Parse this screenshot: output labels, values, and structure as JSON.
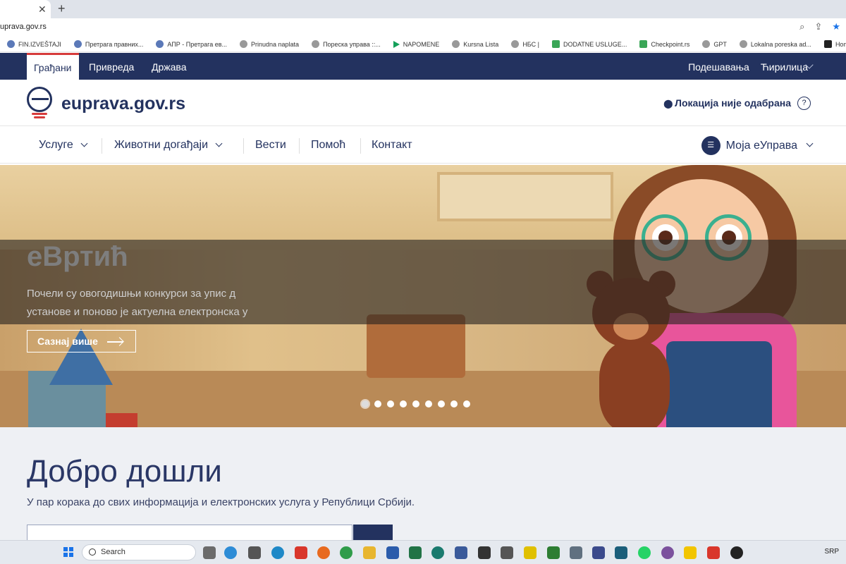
{
  "browser": {
    "url": "uprava.gov.rs",
    "bookmarks": [
      {
        "label": "FIN.IZVEŠTAJI",
        "icon": "globe-icon"
      },
      {
        "label": "Претрага правних...",
        "icon": "globe-icon"
      },
      {
        "label": "АПР - Претрага ев...",
        "icon": "globe-icon"
      },
      {
        "label": "Prinudna naplata",
        "icon": "globe-icon"
      },
      {
        "label": "Пореска управа ::...",
        "icon": "globe-icon"
      },
      {
        "label": "NAPOMENE",
        "icon": "play-icon"
      },
      {
        "label": "Kursna Lista",
        "icon": "globe-icon"
      },
      {
        "label": "НБС |",
        "icon": "globe-icon"
      },
      {
        "label": "DODATNE USLUGE...",
        "icon": "sheet-icon"
      },
      {
        "label": "Checkpoint.rs",
        "icon": "check-icon"
      },
      {
        "label": "GPT",
        "icon": "globe-icon"
      },
      {
        "label": "Lokalna poreska ad...",
        "icon": "globe-icon"
      },
      {
        "label": "Home - Calculus",
        "icon": "sd-icon"
      }
    ]
  },
  "topbar": {
    "segments": [
      "Грађани",
      "Привреда",
      "Држава"
    ],
    "settings": "Подешавања",
    "language": "Ћирилица"
  },
  "header": {
    "logo_text": "euprava.gov.rs",
    "location": "Локација није одабрана",
    "help": "?"
  },
  "nav": {
    "services": "Услуге",
    "life_events": "Животни догађаји",
    "news": "Вести",
    "help": "Помоћ",
    "contact": "Контакт",
    "account": "Моја еУправа"
  },
  "hero": {
    "title": "еВртић",
    "text_line1": "Почели су овогодишњи конкурси за упис д",
    "text_line2": "установе и поново је актуелна електронска у",
    "button": "Сазнај више",
    "slides": 9,
    "active_slide": 1
  },
  "welcome": {
    "title": "Добро дошли",
    "subtitle": "У пар корака до свих информација и електронских услуга у Републици Србији."
  },
  "taskbar": {
    "search": "Search",
    "lang": "SRP"
  }
}
